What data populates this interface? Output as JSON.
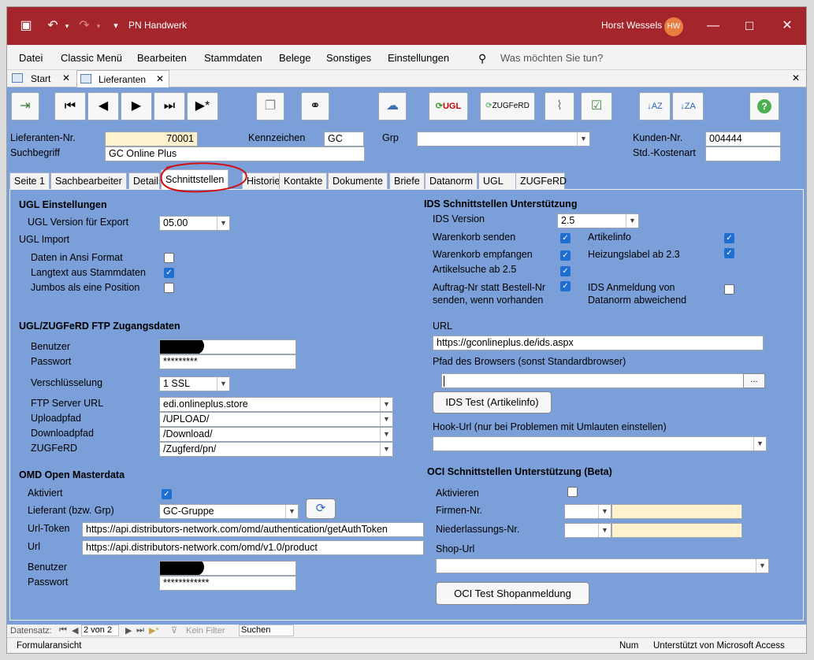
{
  "titlebar": {
    "title": "PN Handwerk",
    "user": "Horst Wessels",
    "initials": "HW"
  },
  "menu": [
    "Datei",
    "Classic Menü",
    "Bearbeiten",
    "Stammdaten",
    "Belege",
    "Sonstiges",
    "Einstellungen"
  ],
  "tellme": "Was möchten Sie tun?",
  "doctabs": [
    "Start",
    "Lieferanten"
  ],
  "toolbar": {
    "ugl": "UGL",
    "zugferd": "ZUGFeRD"
  },
  "header": {
    "lieferanten_nr_label": "Lieferanten-Nr.",
    "lieferanten_nr": "70001",
    "kennzeichen_label": "Kennzeichen",
    "kennzeichen": "GC",
    "grp_label": "Grp",
    "grp": "",
    "kunden_nr_label": "Kunden-Nr.",
    "kunden_nr": "004444",
    "suchbegriff_label": "Suchbegriff",
    "suchbegriff": "GC Online Plus",
    "kostenart_label": "Std.-Kostenart",
    "kostenart": ""
  },
  "formtabs": [
    "Seite 1",
    "Sachbearbeiter",
    "Details",
    "Schnittstellen",
    "Historie",
    "Kontakte",
    "Dokumente",
    "Briefe",
    "Datanorm",
    "UGL",
    "ZUGFeRD"
  ],
  "ugl": {
    "title": "UGL Einstellungen",
    "version_label": "UGL Version für Export",
    "version": "05.00",
    "import_label": "UGL Import",
    "ansi_label": "Daten in Ansi Format",
    "langtext_label": "Langtext aus Stammdaten",
    "jumbos_label": "Jumbos als eine Position"
  },
  "ftp": {
    "title": "UGL/ZUGFeRD FTP Zugangsdaten",
    "benutzer_label": "Benutzer",
    "passwort_label": "Passwort",
    "passwort": "*********",
    "verschl_label": "Verschlüsselung",
    "verschl": "1 SSL",
    "server_label": "FTP Server URL",
    "server": "edi.onlineplus.store",
    "upload_label": "Uploadpfad",
    "upload": "/UPLOAD/",
    "download_label": "Downloadpfad",
    "download": "/Download/",
    "zugferd_label": "ZUGFeRD",
    "zugferd": "/Zugferd/pn/"
  },
  "omd": {
    "title": "OMD Open Masterdata",
    "aktiviert_label": "Aktiviert",
    "lieferant_label": "Lieferant (bzw. Grp)",
    "lieferant": "GC-Gruppe",
    "urltoken_label": "Url-Token",
    "urltoken": "https://api.distributors-network.com/omd/authentication/getAuthToken",
    "url_label": "Url",
    "url": "https://api.distributors-network.com/omd/v1.0/product",
    "benutzer_label": "Benutzer",
    "passwort_label": "Passwort",
    "passwort": "************"
  },
  "ids": {
    "title": "IDS Schnittstellen Unterstützung",
    "version_label": "IDS Version",
    "version": "2.5",
    "warenkorb_senden": "Warenkorb senden",
    "artikelinfo": "Artikelinfo",
    "warenkorb_empfangen": "Warenkorb empfangen",
    "heizungslabel": "Heizungslabel ab 2.3",
    "artikelsuche": "Artikelsuche ab 2.5",
    "auftrag1": "Auftrag-Nr statt Bestell-Nr",
    "auftrag2": "senden, wenn vorhanden",
    "anmeldung1": "IDS Anmeldung von",
    "anmeldung2": "Datanorm abweichend",
    "url_label": "URL",
    "url": "https://gconlineplus.de/ids.aspx",
    "pfad_label": "Pfad des Browsers (sonst Standardbrowser)",
    "browse": "...",
    "test_btn": "IDS Test (Artikelinfo)",
    "hook_label": "Hook-Url (nur bei Problemen mit Umlauten einstellen)"
  },
  "oci": {
    "title": "OCI Schnittstellen Unterstützung (Beta)",
    "aktivieren_label": "Aktivieren",
    "firmen_label": "Firmen-Nr.",
    "niederl_label": "Niederlassungs-Nr.",
    "shop_label": "Shop-Url",
    "test_btn": "OCI Test Shopanmeldung"
  },
  "nav": {
    "label": "Datensatz:",
    "record": "2 von 2",
    "filter": "Kein Filter",
    "search": "Suchen"
  },
  "status": {
    "left": "Formularansicht",
    "num": "Num",
    "right": "Unterstützt von Microsoft Access"
  }
}
